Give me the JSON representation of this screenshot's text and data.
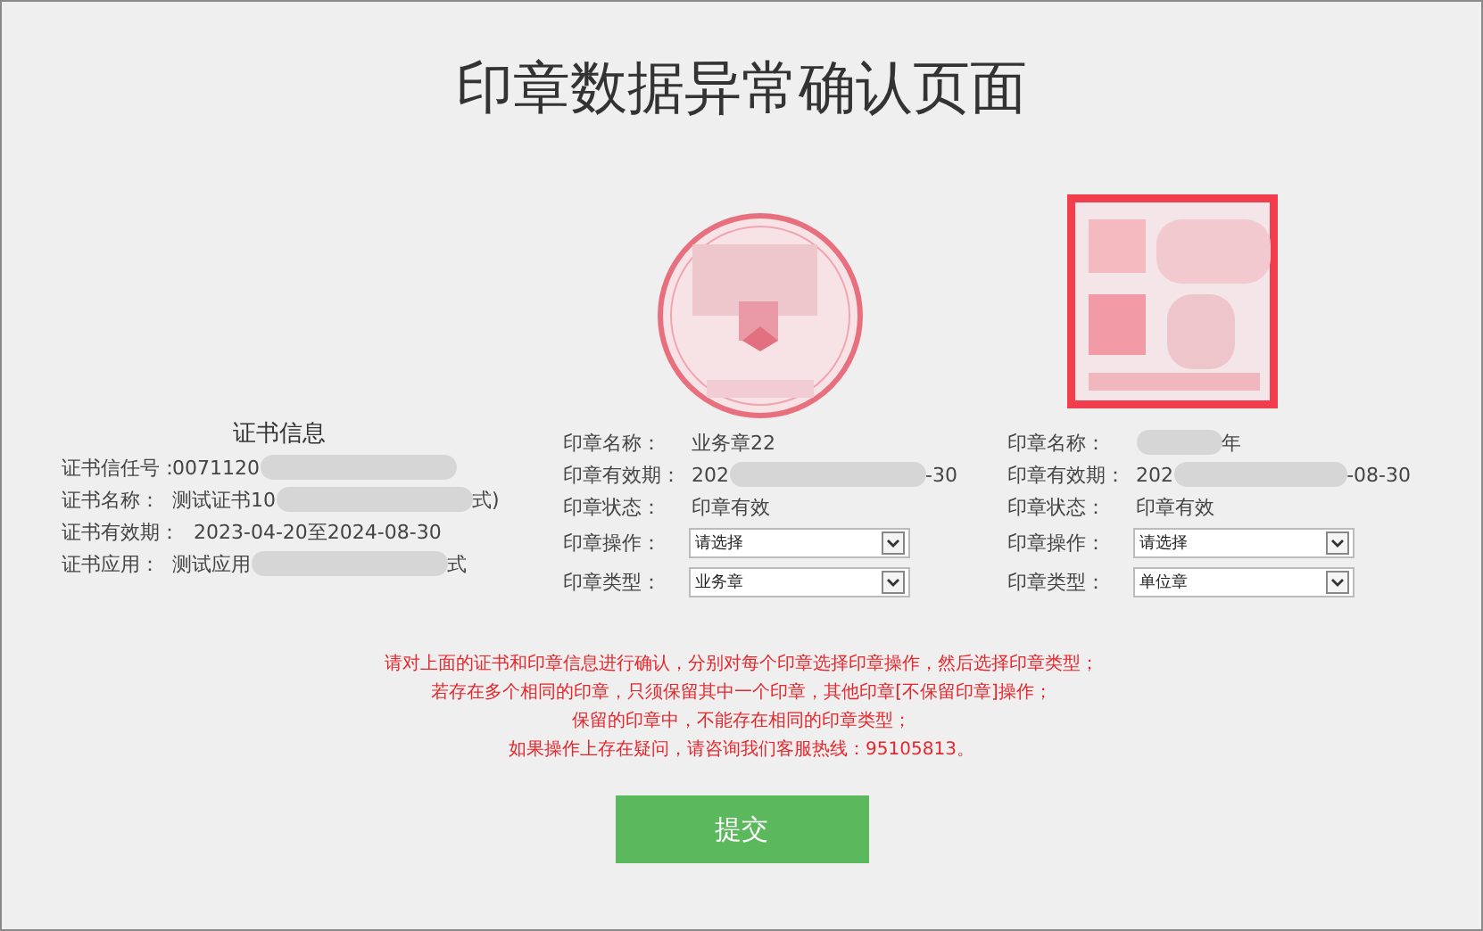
{
  "title": "印章数据异常确认页面",
  "certificate": {
    "heading": "证书信息",
    "rows": [
      {
        "label": "证书信任号：",
        "parts": [
          {
            "kind": "text",
            "text": "0071120"
          },
          {
            "kind": "blur"
          }
        ]
      },
      {
        "label": "证书名称：",
        "parts": [
          {
            "kind": "text",
            "text": "测试证书10"
          },
          {
            "kind": "blur"
          },
          {
            "kind": "text",
            "text": "式)"
          }
        ]
      },
      {
        "label": "证书有效期：",
        "parts": [
          {
            "kind": "text",
            "text": "2023-04-20至2024-08-30"
          }
        ]
      },
      {
        "label": "证书应用：",
        "parts": [
          {
            "kind": "text",
            "text": "测试应用"
          },
          {
            "kind": "blur"
          },
          {
            "kind": "text",
            "text": "式"
          }
        ]
      }
    ]
  },
  "seals": [
    {
      "kind": "round",
      "picture": {
        "kind": "picture"
      },
      "rows": [
        {
          "label": "印章名称：",
          "parts": [
            {
              "kind": "text",
              "text": "业务章22"
            }
          ]
        },
        {
          "label": "印章有效期：",
          "parts": [
            {
              "kind": "text",
              "text": "202"
            },
            {
              "kind": "blur"
            },
            {
              "kind": "text",
              "text": "-30"
            }
          ]
        },
        {
          "label": "印章状态：",
          "parts": [
            {
              "kind": "text",
              "text": "印章有效"
            }
          ]
        }
      ],
      "selects": [
        {
          "label": "印章操作：",
          "value": "请选择"
        },
        {
          "label": "印章类型：",
          "value": "业务章"
        }
      ]
    },
    {
      "kind": "square",
      "picture": {
        "kind": "picture"
      },
      "rows": [
        {
          "label": "印章名称：",
          "parts": [
            {
              "kind": "blur"
            },
            {
              "kind": "text",
              "text": "年"
            }
          ]
        },
        {
          "label": "印章有效期：",
          "parts": [
            {
              "kind": "text",
              "text": "202"
            },
            {
              "kind": "blur"
            },
            {
              "kind": "text",
              "text": "-08-30"
            }
          ]
        },
        {
          "label": "印章状态：",
          "parts": [
            {
              "kind": "text",
              "text": "印章有效"
            }
          ]
        }
      ],
      "selects": [
        {
          "label": "印章操作：",
          "value": "请选择"
        },
        {
          "label": "印章类型：",
          "value": "单位章"
        }
      ]
    }
  ],
  "notes": [
    "请对上面的证书和印章信息进行确认，分别对每个印章选择印章操作，然后选择印章类型；",
    "若存在多个相同的印章，只须保留其中一个印章，其他印章[不保留印章]操作；",
    "保留的印章中，不能存在相同的印章类型；",
    "如果操作上存在疑问，请咨询我们客服热线：95105813。"
  ],
  "submit": "提交"
}
